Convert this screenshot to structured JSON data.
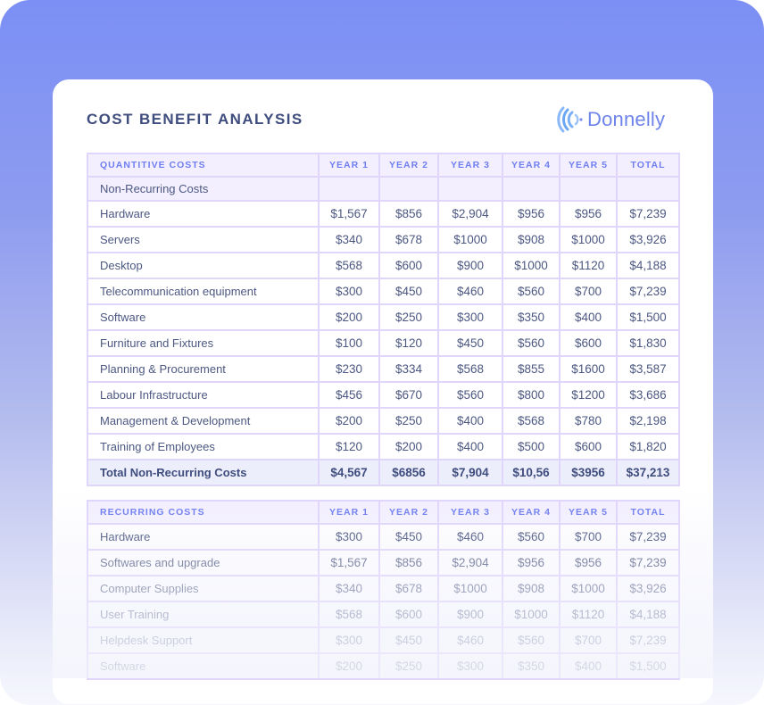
{
  "document": {
    "title": "COST BENEFIT ANALYSIS",
    "brand": {
      "name": "Donnelly",
      "icon": "concentric-arcs-logo-icon",
      "color": "#6f84ea"
    },
    "colors": {
      "header_text": "#6f7ef0",
      "border": "#e0d5fb",
      "header_bg": "#f3efff",
      "total_bg": "#eceefb",
      "title": "#3f4d7e"
    }
  },
  "quantitive": {
    "headers": [
      "QUANTITIVE COSTS",
      "YEAR 1",
      "YEAR 2",
      "YEAR 3",
      "YEAR 4",
      "YEAR 5",
      "TOTAL"
    ],
    "subheader": "Non-Recurring Costs",
    "rows": [
      [
        "Hardware",
        "$1,567",
        "$856",
        "$2,904",
        "$956",
        "$956",
        "$7,239"
      ],
      [
        "Servers",
        "$340",
        "$678",
        "$1000",
        "$908",
        "$1000",
        "$3,926"
      ],
      [
        "Desktop",
        "$568",
        "$600",
        "$900",
        "$1000",
        "$1120",
        "$4,188"
      ],
      [
        "Telecommunication equipment",
        "$300",
        "$450",
        "$460",
        "$560",
        "$700",
        "$7,239"
      ],
      [
        "Software",
        "$200",
        "$250",
        "$300",
        "$350",
        "$400",
        "$1,500"
      ],
      [
        "Furniture and Fixtures",
        "$100",
        "$120",
        "$450",
        "$560",
        "$600",
        "$1,830"
      ],
      [
        "Planning & Procurement",
        "$230",
        "$334",
        "$568",
        "$855",
        "$1600",
        "$3,587"
      ],
      [
        "Labour Infrastructure",
        "$456",
        "$670",
        "$560",
        "$800",
        "$1200",
        "$3,686"
      ],
      [
        "Management & Development",
        "$200",
        "$250",
        "$400",
        "$568",
        "$780",
        "$2,198"
      ],
      [
        "Training of Employees",
        "$120",
        "$200",
        "$400",
        "$500",
        "$600",
        "$1,820"
      ]
    ],
    "total": [
      "Total Non-Recurring Costs",
      "$4,567",
      "$6856",
      "$7,904",
      "$10,56",
      "$3956",
      "$37,213"
    ]
  },
  "recurring": {
    "headers": [
      "RECURRING COSTS",
      "YEAR 1",
      "YEAR 2",
      "YEAR 3",
      "YEAR 4",
      "YEAR 5",
      "TOTAL"
    ],
    "rows": [
      [
        "Hardware",
        "$300",
        "$450",
        "$460",
        "$560",
        "$700",
        "$7,239"
      ],
      [
        "Softwares and upgrade",
        "$1,567",
        "$856",
        "$2,904",
        "$956",
        "$956",
        "$7,239"
      ],
      [
        "Computer Supplies",
        "$340",
        "$678",
        "$1000",
        "$908",
        "$1000",
        "$3,926"
      ],
      [
        "User Training",
        "$568",
        "$600",
        "$900",
        "$1000",
        "$1120",
        "$4,188"
      ],
      [
        "Helpdesk Support",
        "$300",
        "$450",
        "$460",
        "$560",
        "$700",
        "$7,239"
      ],
      [
        "Software",
        "$200",
        "$250",
        "$300",
        "$350",
        "$400",
        "$1,500"
      ]
    ]
  }
}
